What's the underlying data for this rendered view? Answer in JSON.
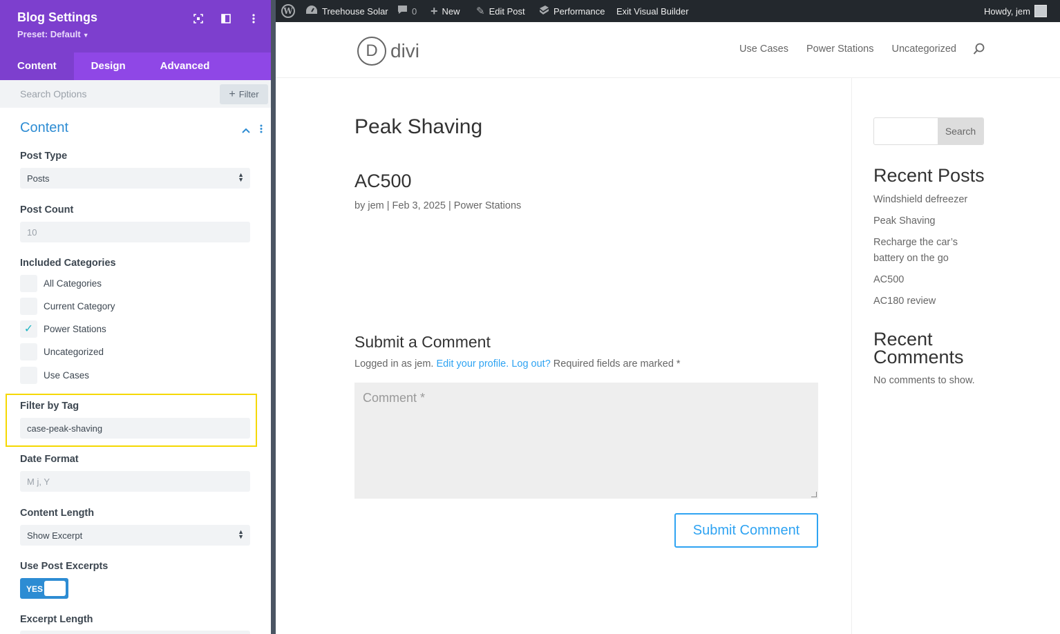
{
  "panel": {
    "title": "Blog Settings",
    "preset": "Preset: Default",
    "tabs": [
      "Content",
      "Design",
      "Advanced"
    ],
    "search_placeholder": "Search Options",
    "filter_label": "Filter",
    "section_title": "Content",
    "post_type": {
      "label": "Post Type",
      "value": "Posts"
    },
    "post_count": {
      "label": "Post Count",
      "placeholder": "10"
    },
    "included_categories": {
      "label": "Included Categories",
      "items": [
        {
          "label": "All Categories",
          "checked": false
        },
        {
          "label": "Current Category",
          "checked": false
        },
        {
          "label": "Power Stations",
          "checked": true
        },
        {
          "label": "Uncategorized",
          "checked": false
        },
        {
          "label": "Use Cases",
          "checked": false
        }
      ]
    },
    "filter_by_tag": {
      "label": "Filter by Tag",
      "value": "case-peak-shaving"
    },
    "date_format": {
      "label": "Date Format",
      "placeholder": "M j, Y"
    },
    "content_length": {
      "label": "Content Length",
      "value": "Show Excerpt"
    },
    "use_post_excerpts": {
      "label": "Use Post Excerpts",
      "toggle": "YES"
    },
    "excerpt_length": {
      "label": "Excerpt Length"
    }
  },
  "adminbar": {
    "site_name": "Treehouse Solar",
    "comments_count": "0",
    "new_label": "New",
    "edit_post": "Edit Post",
    "performance": "Performance",
    "exit_builder": "Exit Visual Builder",
    "howdy": "Howdy, jem"
  },
  "site": {
    "logo_letter": "D",
    "logo_text": "divi",
    "nav": [
      "Use Cases",
      "Power Stations",
      "Uncategorized"
    ],
    "page_title": "Peak Shaving",
    "post": {
      "title": "AC500",
      "meta": "by jem | Feb 3, 2025 | Power Stations"
    },
    "comment": {
      "heading": "Submit a Comment",
      "logged_prefix": "Logged in as jem.",
      "edit_profile": "Edit your profile.",
      "log_out": "Log out?",
      "required": "Required fields are marked *",
      "placeholder": "Comment *",
      "submit": "Submit Comment"
    },
    "sidebar": {
      "search_button": "Search",
      "recent_posts_title": "Recent Posts",
      "recent_posts": [
        "Windshield defreezer",
        "Peak Shaving",
        "Recharge the car’s battery on the go",
        "AC500",
        "AC180 review"
      ],
      "recent_comments_title": "Recent Comments",
      "no_comments": "No comments to show."
    }
  }
}
